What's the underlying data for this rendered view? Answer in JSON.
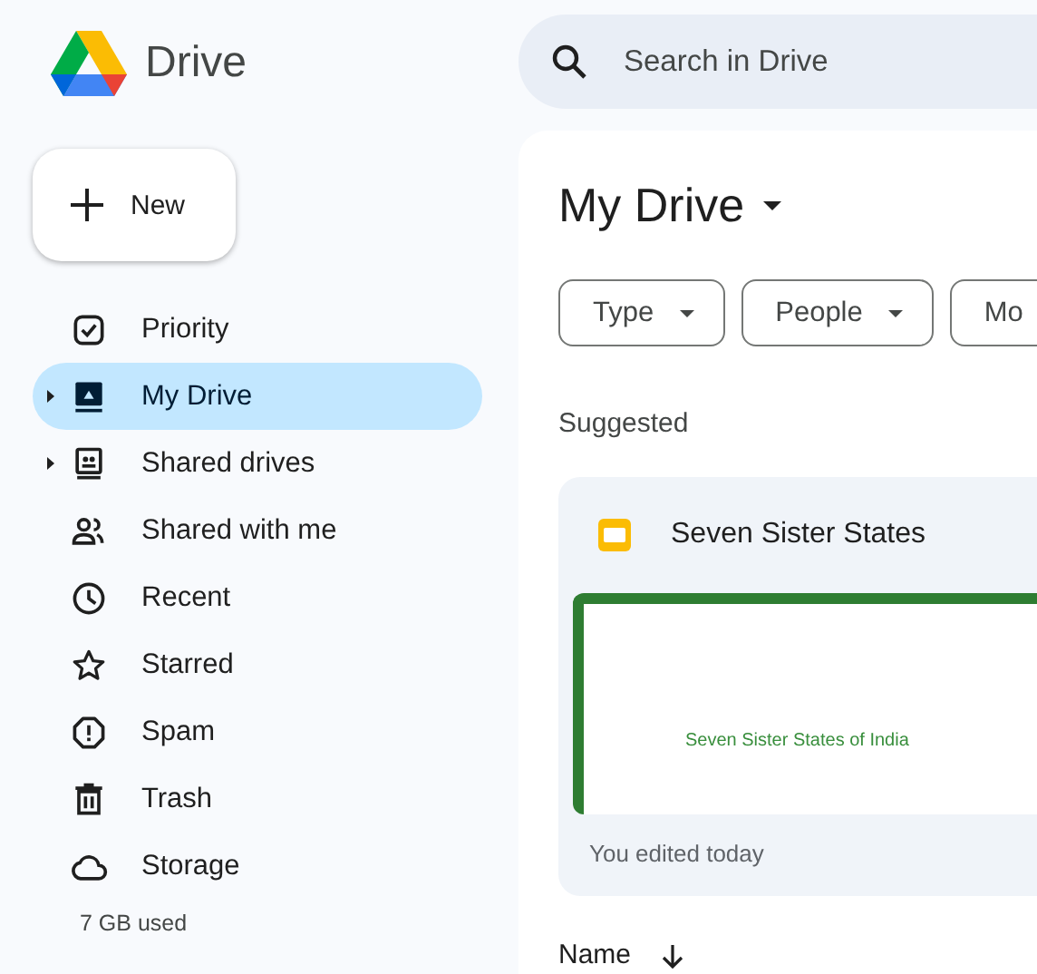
{
  "app": {
    "name": "Drive"
  },
  "new_button": {
    "label": "New"
  },
  "sidebar": {
    "items": [
      {
        "label": "Priority",
        "expandable": false,
        "selected": false
      },
      {
        "label": "My Drive",
        "expandable": true,
        "selected": true
      },
      {
        "label": "Shared drives",
        "expandable": true,
        "selected": false
      },
      {
        "label": "Shared with me",
        "expandable": false,
        "selected": false
      },
      {
        "label": "Recent",
        "expandable": false,
        "selected": false
      },
      {
        "label": "Starred",
        "expandable": false,
        "selected": false
      },
      {
        "label": "Spam",
        "expandable": false,
        "selected": false
      },
      {
        "label": "Trash",
        "expandable": false,
        "selected": false
      },
      {
        "label": "Storage",
        "expandable": false,
        "selected": false
      }
    ],
    "storage_used": "7 GB used"
  },
  "search": {
    "placeholder": "Search in Drive"
  },
  "main": {
    "title": "My Drive",
    "filters": [
      {
        "label": "Type",
        "caret": true
      },
      {
        "label": "People",
        "caret": true
      },
      {
        "label": "Mo",
        "caret": false
      }
    ],
    "section": "Suggested",
    "card": {
      "title": "Seven Sister States",
      "preview_text": "Seven Sister States of India",
      "subtitle": "You edited today"
    },
    "columns": [
      {
        "label": "Name"
      }
    ]
  }
}
